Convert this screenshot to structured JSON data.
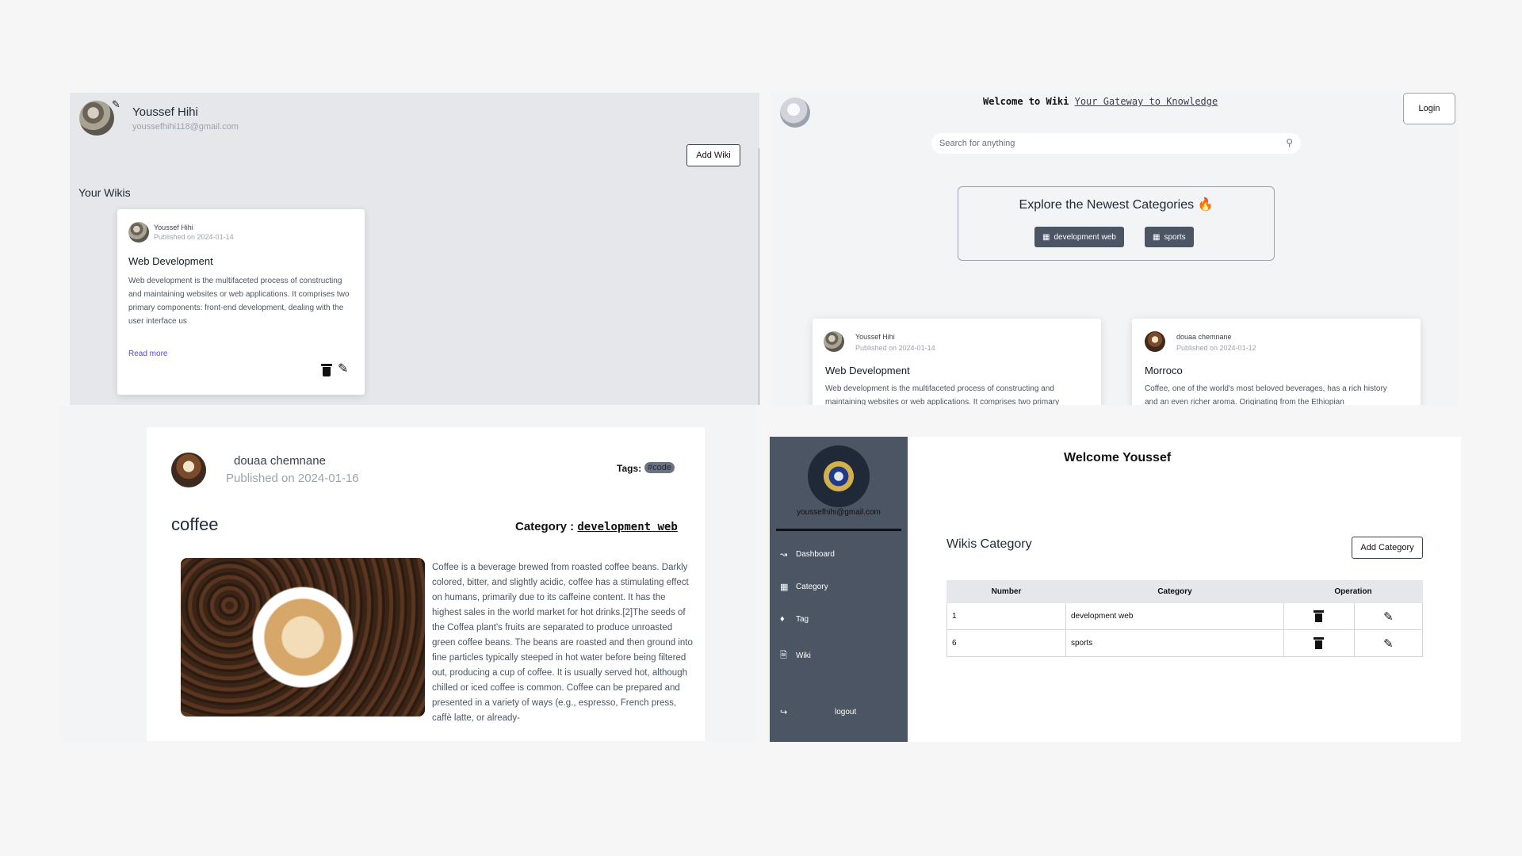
{
  "profile": {
    "name": "Youssef Hihi",
    "email": "youssefhihi118@gmail.com",
    "add_wiki_label": "Add Wiki",
    "your_wikis_label": "Your Wikis",
    "card": {
      "author": "Youssef Hihi",
      "date": "Published on 2024-01-14",
      "title": "Web Development",
      "text": "Web development is the multifaceted process of constructing and maintaining websites or web applications. It comprises two primary components: front-end development, dealing with the user interface us",
      "read_more": "Read more"
    }
  },
  "home": {
    "welcome_prefix": "Welcome to Wiki",
    "welcome_link": "Your Gateway to Knowledge",
    "login_label": "Login",
    "search_placeholder": "Search for anything",
    "explore_title": "Explore the Newest Categories",
    "categories": [
      "development web",
      "sports"
    ],
    "cards": [
      {
        "author": "Youssef Hihi",
        "date": "Published on 2024-01-14",
        "title": "Web Development",
        "text": "Web development is the multifaceted process of constructing and maintaining websites or web applications. It comprises two primary"
      },
      {
        "author": "douaa chemnane",
        "date": "Published on 2024-01-12",
        "title": "Morroco",
        "text": "Coffee, one of the world's most beloved beverages, has a rich history and an even richer aroma. Originating from the Ethiopian"
      }
    ]
  },
  "article": {
    "author": "douaa chemnane",
    "date": "Published on 2024-01-16",
    "tags_label": "Tags:",
    "tag": "#code",
    "title": "coffee",
    "category_label": "Category :",
    "category_value": "development web",
    "body": "Coffee is a beverage brewed from roasted coffee beans. Darkly colored, bitter, and slightly acidic, coffee has a stimulating effect on humans, primarily due to its caffeine content. It has the highest sales in the world market for hot drinks.[2]The seeds of the Coffea plant's fruits are separated to produce unroasted green coffee beans. The beans are roasted and then ground into fine particles typically steeped in hot water before being filtered out, producing a cup of coffee. It is usually served hot, although chilled or iced coffee is common. Coffee can be prepared and presented in a variety of ways (e.g., espresso, French press, caffè latte, or already-"
  },
  "dashboard": {
    "email": "youssefhihi@gmail.com",
    "nav": [
      "Dashboard",
      "Category",
      "Tag",
      "Wiki",
      "logout"
    ],
    "welcome": "Welcome Youssef",
    "section_title": "Wikis Category",
    "add_category_label": "Add Category",
    "columns": [
      "Number",
      "Category",
      "Operation"
    ],
    "rows": [
      {
        "number": "1",
        "category": "development web"
      },
      {
        "number": "6",
        "category": "sports"
      }
    ]
  }
}
